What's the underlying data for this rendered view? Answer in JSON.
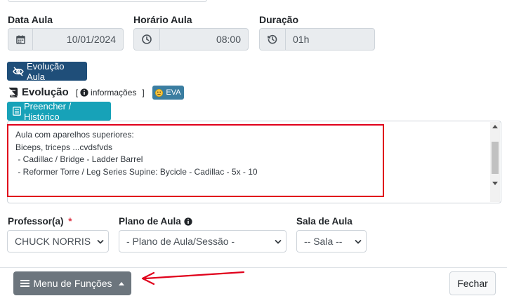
{
  "fields": {
    "date_label": "Data Aula",
    "date_value": "10/01/2024",
    "time_label": "Horário Aula",
    "time_value": "08:00",
    "duration_label": "Duração",
    "duration_value": "01h"
  },
  "buttons": {
    "evolution_toggle": "Evolução Aula",
    "fill_history": "Preencher / Histórico",
    "eva": "EVA",
    "menu_functions": "Menu de Funções",
    "close": "Fechar"
  },
  "evolution": {
    "title": "Evolução",
    "info_open": "[",
    "info_label": "informações",
    "info_close": "]",
    "text_lines": [
      "Aula com aparelhos superiores:",
      "Biceps, triceps ...cvdsfvds",
      " - Cadillac / Bridge - Ladder Barrel",
      " - Reformer Torre / Leg Series Supine: Bycicle - Cadillac - 5x - 10"
    ]
  },
  "selects": {
    "professor_label": "Professor(a)",
    "professor_required": "*",
    "professor_value": "CHUCK NORRIS",
    "plan_label": "Plano de Aula",
    "plan_value": "- Plano de Aula/Sessão -",
    "room_label": "Sala de Aula",
    "room_value": "-- Sala --"
  },
  "icons": {
    "calendar": "calendar-icon",
    "clock": "clock-icon",
    "history": "history-icon",
    "eye_slash": "eye-slash-icon",
    "book": "book-icon",
    "info": "info-icon",
    "emoji": "emoji-icon",
    "list": "list-icon",
    "hamburger": "hamburger-icon",
    "caret": "caret-up-icon"
  },
  "colors": {
    "primary_dark": "#1f4e79",
    "teal": "#17a2b8",
    "eva_bg": "#3b7ea1",
    "highlight_red": "#e0001b",
    "required_red": "#dc3545",
    "menu_btn": "#6c757d"
  }
}
